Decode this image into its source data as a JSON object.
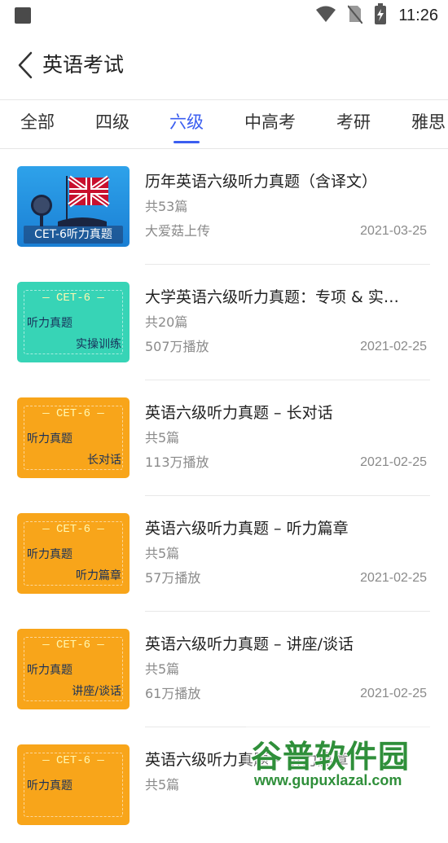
{
  "status_bar": {
    "time": "11:26"
  },
  "header": {
    "title": "英语考试"
  },
  "tabs": [
    {
      "label": "全部"
    },
    {
      "label": "四级"
    },
    {
      "label": "六级"
    },
    {
      "label": "中高考"
    },
    {
      "label": "考研"
    },
    {
      "label": "雅思"
    }
  ],
  "active_tab": "六级",
  "colors": {
    "accent": "#3b5ef0",
    "thumb_teal": "#37d4b6",
    "thumb_orange": "#f8a51a",
    "thumb_blue": "#1a7fd4"
  },
  "items": [
    {
      "title": "历年英语六级听力真题（含译文）",
      "count": "共53篇",
      "meta": "大爱菇上传",
      "date": "2021-03-25",
      "thumb": {
        "style": "blue",
        "caption": "CET-6听力真题"
      }
    },
    {
      "title": "大学英语六级听力真题：专项 & 实操训练",
      "count": "共20篇",
      "meta": "507万播放",
      "date": "2021-02-25",
      "thumb": {
        "style": "teal",
        "cet": "— CET-6 —",
        "line1": "听力真题",
        "line2": "实操训练"
      }
    },
    {
      "title": "英语六级听力真题 – 长对话",
      "count": "共5篇",
      "meta": "113万播放",
      "date": "2021-02-25",
      "thumb": {
        "style": "orange",
        "cet": "— CET-6 —",
        "line1": "听力真题",
        "line2": "长对话"
      }
    },
    {
      "title": "英语六级听力真题 – 听力篇章",
      "count": "共5篇",
      "meta": "57万播放",
      "date": "2021-02-25",
      "thumb": {
        "style": "orange",
        "cet": "— CET-6 —",
        "line1": "听力真题",
        "line2": "听力篇章"
      }
    },
    {
      "title": "英语六级听力真题 – 讲座/谈话",
      "count": "共5篇",
      "meta": "61万播放",
      "date": "2021-02-25",
      "thumb": {
        "style": "orange",
        "cet": "— CET-6 —",
        "line1": "听力真题",
        "line2": "讲座/谈话"
      }
    },
    {
      "title": "英语六级听力真题 – 听力篇章",
      "count": "共5篇",
      "meta": "",
      "date": "",
      "thumb": {
        "style": "orange",
        "cet": "— CET-6 —",
        "line1": "听力真题",
        "line2": ""
      }
    }
  ],
  "watermark": {
    "logo": "谷普软件园",
    "url": "www.gupuxlazal.com"
  }
}
